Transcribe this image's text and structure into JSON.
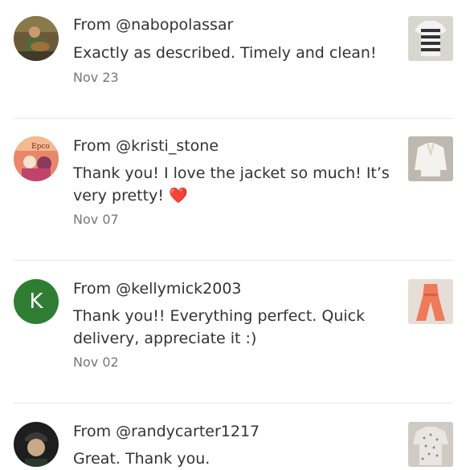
{
  "reviews": [
    {
      "from": "From @nabopolassar",
      "message": "Exactly as described. Timely and clean!",
      "date": "Nov 23",
      "avatar_icon": "user-photo-guitar",
      "thumb_icon": "striped-shirt"
    },
    {
      "from": "From @kristi_stone",
      "message": "Thank you! I love the jacket so much! It’s very pretty!",
      "emoji": "❤️",
      "date": "Nov 07",
      "avatar_icon": "user-photo-epcot",
      "thumb_icon": "white-jacket"
    },
    {
      "from": "From @kellymick2003",
      "message": "Thank you!! Everything perfect. Quick delivery, appreciate it :)",
      "date": "Nov 02",
      "avatar_letter": "K",
      "avatar_color": "#2e7d32",
      "thumb_icon": "coral-jumpsuit"
    },
    {
      "from": "From @randycarter1217",
      "message": "Great. Thank you.",
      "avatar_icon": "user-photo-cap",
      "thumb_icon": "patterned-shirt"
    }
  ]
}
